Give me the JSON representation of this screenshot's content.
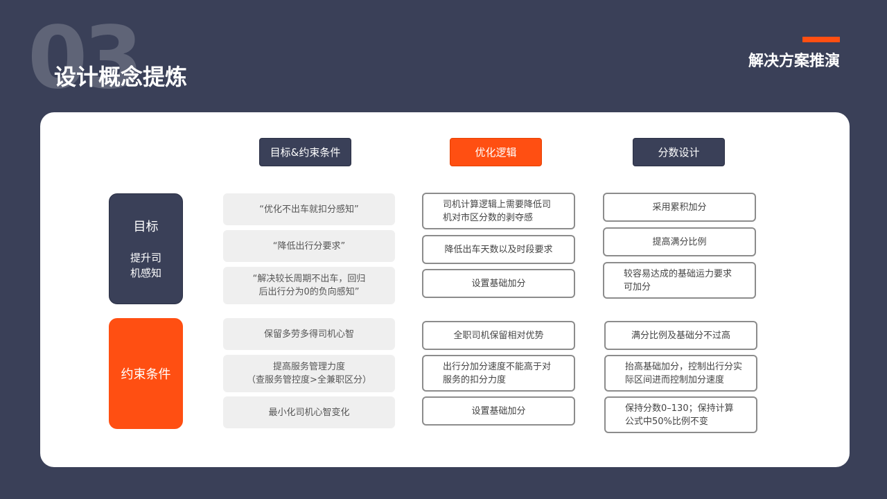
{
  "page": {
    "number": "03",
    "title": "设计概念提炼",
    "section": "解决方案推演"
  },
  "colors": {
    "background": "#3a4058",
    "accent": "#ff4f12",
    "card": "#ffffff",
    "gray_box": "#efefef",
    "box_border": "#8c8c8c"
  },
  "headers": {
    "goals_constraints": "目标&约束条件",
    "logic": "优化逻辑",
    "score": "分数设计"
  },
  "rows": {
    "goal": {
      "label": "目标",
      "sub": "提升司\n机感知",
      "items": [
        "“优化不出车就扣分感知”",
        "“降低出行分要求”",
        "“解决较长周期不出车，回归\n后出行分为0的负向感知”"
      ],
      "logic": [
        "司机计算逻辑上需要降低司\n机对市区分数的剥夺感",
        "降低出车天数以及时段要求",
        "设置基础加分"
      ],
      "score": [
        "采用累积加分",
        "提高满分比例",
        "较容易达成的基础运力要求\n可加分"
      ]
    },
    "constraint": {
      "label": "约束条件",
      "items": [
        "保留多劳多得司机心智",
        "提高服务管理力度\n（查服务管控度>全兼职区分）",
        "最小化司机心智变化"
      ],
      "logic": [
        "全职司机保留相对优势",
        "出行分加分速度不能高于对\n服务的扣分力度",
        "设置基础加分"
      ],
      "score": [
        "满分比例及基础分不过高",
        "抬高基础加分，控制出行分实\n际区间进而控制加分速度",
        "保持分数0–130；保持计算\n公式中50%比例不变"
      ]
    }
  }
}
